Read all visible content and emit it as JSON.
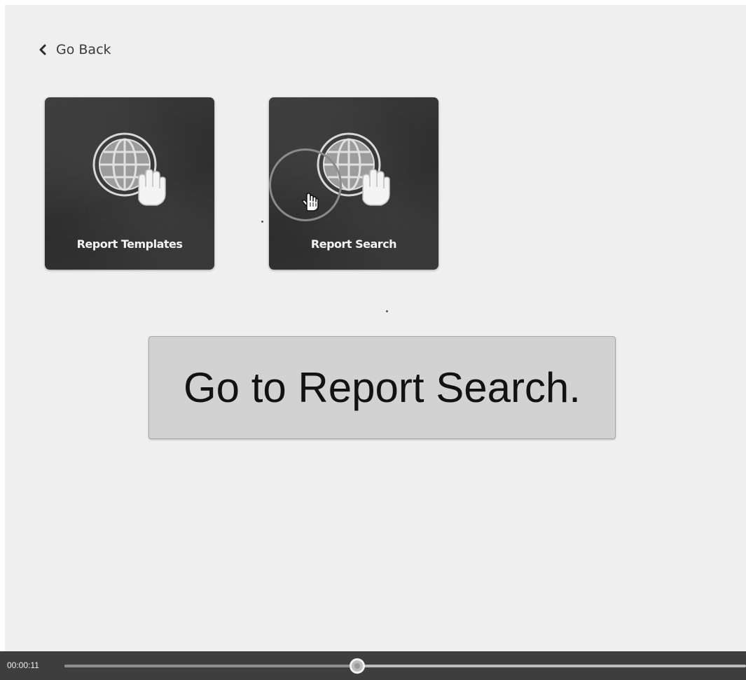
{
  "navigation": {
    "back_label": "Go Back",
    "back_icon": "chevron-left-icon"
  },
  "tiles": [
    {
      "label": "Report Templates",
      "icon": "globe-hand-icon"
    },
    {
      "label": "Report Search",
      "icon": "globe-hand-icon"
    }
  ],
  "caption": {
    "text": "Go to Report Search."
  },
  "player": {
    "time": "00:00:11",
    "progress": 0.43
  },
  "colors": {
    "page_background": "#efefef",
    "tile_background": "#2c2c2c",
    "caption_background": "#d2d2d2",
    "player_background": "#3e3e3e"
  }
}
